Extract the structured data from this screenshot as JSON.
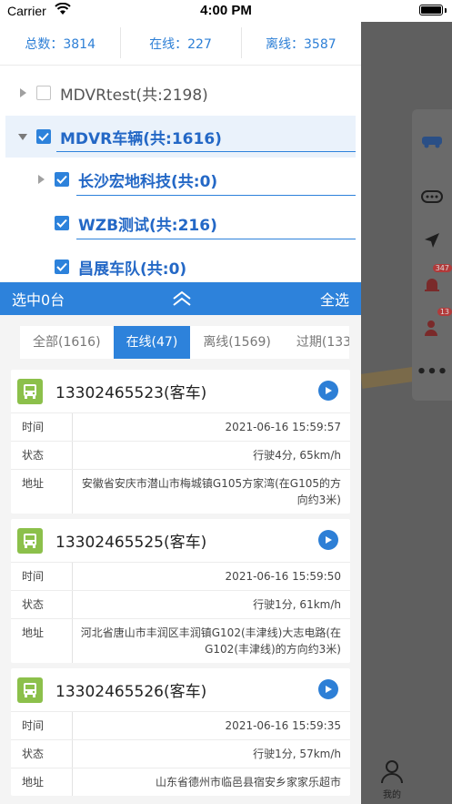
{
  "status_bar": {
    "carrier": "Carrier",
    "time": "4:00 PM"
  },
  "summary": {
    "total": "总数：3814",
    "online": "在线：227",
    "offline": "离线：3587"
  },
  "tree": [
    {
      "label": "MDVRtest(共:2198)",
      "checked": false
    },
    {
      "label": "MDVR车辆(共:1616)",
      "checked": true
    },
    {
      "label": "长沙宏地科技(共:0)",
      "checked": true
    },
    {
      "label": "WZB测试(共:216)",
      "checked": true
    },
    {
      "label": "昌展车队(共:0)",
      "checked": true
    }
  ],
  "select_bar": {
    "selected": "选中0台",
    "select_all": "全选"
  },
  "filter_tabs": [
    {
      "label": "全部(1616)",
      "active": false
    },
    {
      "label": "在线(47)",
      "active": true
    },
    {
      "label": "离线(1569)",
      "active": false
    },
    {
      "label": "过期(133",
      "active": false
    }
  ],
  "row_labels": {
    "time": "时间",
    "status": "状态",
    "address": "地址"
  },
  "vehicles": [
    {
      "name": "13302465523(客车)",
      "time": "2021-06-16 15:59:57",
      "status": "行驶4分, 65km/h",
      "address": "安徽省安庆市潜山市梅城镇G105方家湾(在G105的方向约3米)"
    },
    {
      "name": "13302465525(客车)",
      "time": "2021-06-16 15:59:50",
      "status": "行驶1分, 61km/h",
      "address": "河北省唐山市丰润区丰润镇G102(丰津线)大志电路(在G102(丰津线)的方向约3米)"
    },
    {
      "name": "13302465526(客车)",
      "time": "2021-06-16 15:59:35",
      "status": "行驶1分, 57km/h",
      "address": "山东省德州市临邑县宿安乡家家乐超市"
    }
  ],
  "map_tools": {
    "badge_alarm": "347",
    "badge_user": "13"
  },
  "tabbar": {
    "mine": "我的"
  },
  "colors": {
    "accent": "#2d82db",
    "bus_icon": "#8cc04b"
  }
}
